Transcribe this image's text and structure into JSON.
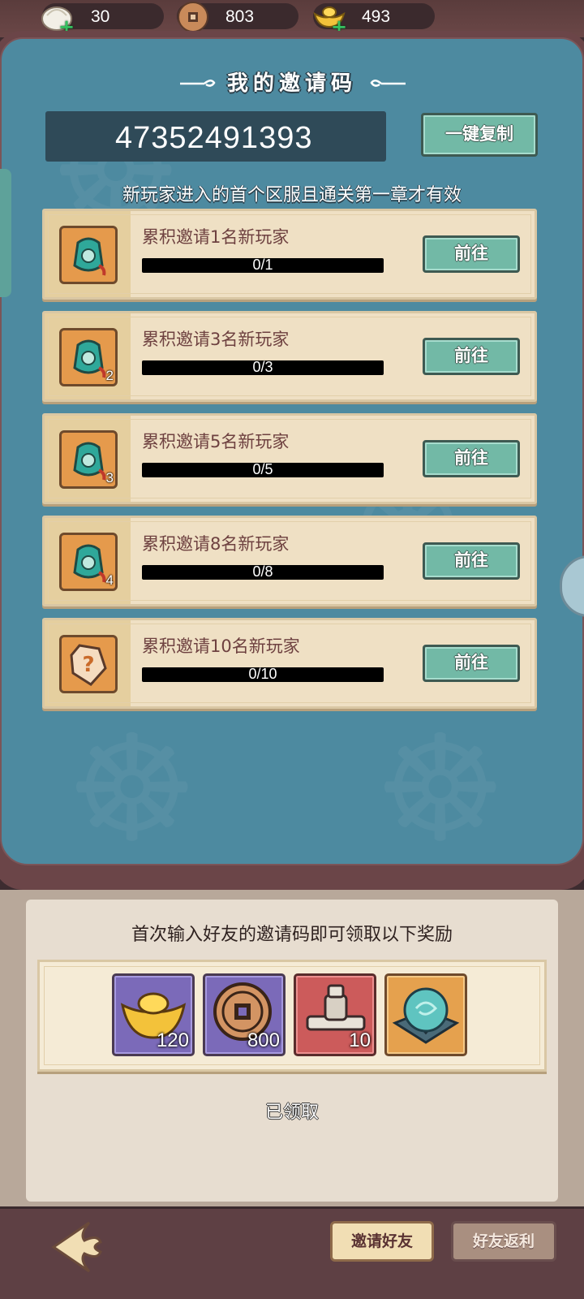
{
  "resources": [
    {
      "name": "steamed-bun",
      "value": "30"
    },
    {
      "name": "copper-coin",
      "value": "803"
    },
    {
      "name": "gold-ingot",
      "value": "493"
    }
  ],
  "invite": {
    "title": "我的邀请码",
    "code": "47352491393",
    "copy_label": "一键复制",
    "notice": "新玩家进入的首个区服且通关第一章才有效"
  },
  "tasks": [
    {
      "title": "累积邀请1名新玩家",
      "progress": "0/1",
      "progress_fraction": 0,
      "badge": "",
      "button": "前往"
    },
    {
      "title": "累积邀请3名新玩家",
      "progress": "0/3",
      "progress_fraction": 0,
      "badge": "2",
      "button": "前往"
    },
    {
      "title": "累积邀请5名新玩家",
      "progress": "0/5",
      "progress_fraction": 0,
      "badge": "3",
      "button": "前往"
    },
    {
      "title": "累积邀请8名新玩家",
      "progress": "0/8",
      "progress_fraction": 0,
      "badge": "4",
      "button": "前往"
    },
    {
      "title": "累积邀请10名新玩家",
      "progress": "0/10",
      "progress_fraction": 0,
      "badge": "",
      "button": "前往"
    }
  ],
  "first_input_reward": {
    "heading": "首次输入好友的邀请码即可领取以下奖励",
    "items": [
      {
        "icon": "gold-ingot-icon",
        "count": "120",
        "rarity": "purple"
      },
      {
        "icon": "copper-coin-icon",
        "count": "800",
        "rarity": "purple"
      },
      {
        "icon": "millstone-icon",
        "count": "10",
        "rarity": "red"
      },
      {
        "icon": "jade-orb-icon",
        "count": "",
        "rarity": "orange"
      }
    ],
    "status": "已领取"
  },
  "nav": {
    "invite_friends": "邀请好友",
    "friend_rebate": "好友返利"
  },
  "colors": {
    "panel_teal": "#4d8aa0",
    "button_teal": "#72b9a6",
    "card_cream": "#efe0c4",
    "frame_brown": "#6b4548"
  }
}
